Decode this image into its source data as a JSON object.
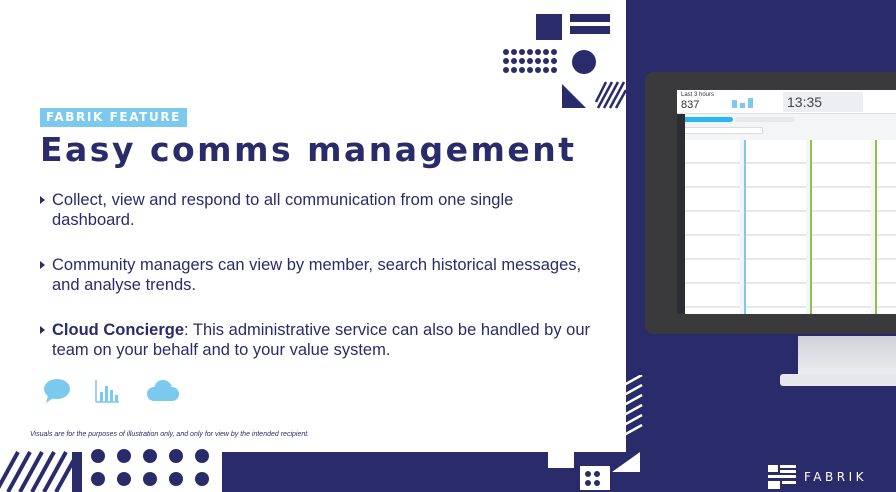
{
  "tag": "FABRIK FEATURE",
  "title": "Easy comms management",
  "bullets": [
    {
      "bold": "",
      "text": "Collect, view and respond to  all communication from one single dashboard."
    },
    {
      "bold": "",
      "text": "Community managers can view by member, search historical messages, and analyse trends."
    },
    {
      "bold": "Cloud Concierge",
      "text": ": This administrative service can also be handled by our team on your behalf and to your value system."
    }
  ],
  "feature_icons": [
    "chat-bubble-icon",
    "bar-chart-icon",
    "cloud-icon"
  ],
  "disclaimer": "Visuals are for the purposes of illustration only,  and only for view by the intended recipient.",
  "brand": "FABRIK",
  "dashboard": {
    "period_label": "Last 3 hours",
    "count": "837",
    "clock": "13:35"
  },
  "colors": {
    "navy": "#2a2b6a",
    "accent_blue": "#7cc9ee",
    "white": "#ffffff"
  }
}
